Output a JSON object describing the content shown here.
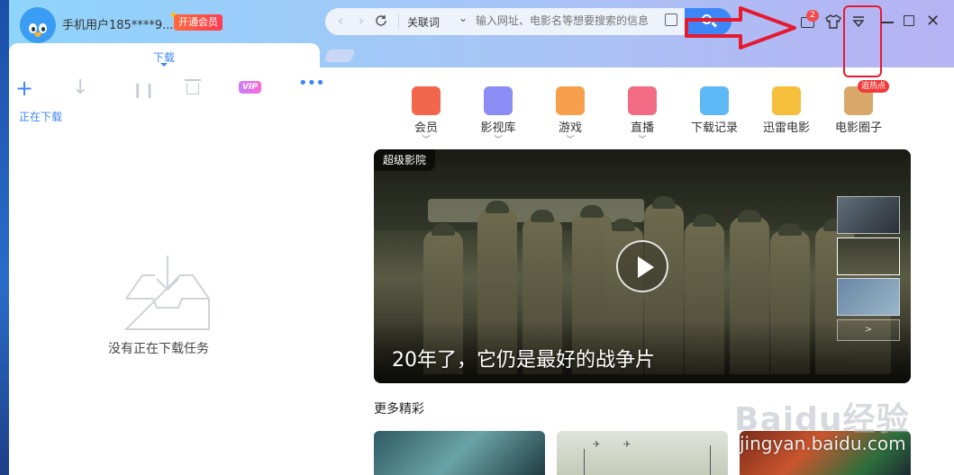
{
  "user": {
    "name": "手机用户185****9...",
    "vip_button": "开通会员"
  },
  "address_bar": {
    "back_icon": "chevron-left-icon",
    "forward_icon": "chevron-right-icon",
    "refresh_icon": "refresh-icon",
    "mode_label": "关联词",
    "placeholder": "输入网址、电影名等想要搜索的信息"
  },
  "window": {
    "message_count": "2"
  },
  "tabs": [
    {
      "label": "下载"
    }
  ],
  "download_panel": {
    "section_label": "正在下载",
    "toolbar": {
      "vip_label": "VIP"
    },
    "empty_text": "没有正在下载任务"
  },
  "nav": [
    {
      "label": "会员",
      "icon": "heart-v-icon",
      "color": "#f2664d",
      "has_chevron": true
    },
    {
      "label": "影视库",
      "icon": "film-icon",
      "color": "#8c8df4",
      "has_chevron": true
    },
    {
      "label": "游戏",
      "icon": "gamepad-icon",
      "color": "#f6a04c",
      "has_chevron": true
    },
    {
      "label": "直播",
      "icon": "tv-icon",
      "color": "#f26d84",
      "has_chevron": true
    },
    {
      "label": "下载记录",
      "icon": "cloud-icon",
      "color": "#5eb8f5",
      "has_chevron": false
    },
    {
      "label": "迅雷电影",
      "icon": "thunder-bird-icon",
      "color": "#f5bf3b",
      "has_chevron": false
    },
    {
      "label": "电影圈子",
      "icon": "circle-icon",
      "color": "#d9a86a",
      "has_chevron": false,
      "badge": "追热点"
    }
  ],
  "banner": {
    "tag": "超级影院",
    "title": "20年了，它仍是最好的战争片",
    "next_label": ">"
  },
  "more_section": {
    "title": "更多精彩"
  },
  "watermark": {
    "logo": "Baidu经验",
    "url": "jingyan.baidu.com"
  },
  "colors": {
    "accent": "#3d86f7",
    "annotation_red": "#e61a2f",
    "vip_orange": "#ff4f4a"
  }
}
